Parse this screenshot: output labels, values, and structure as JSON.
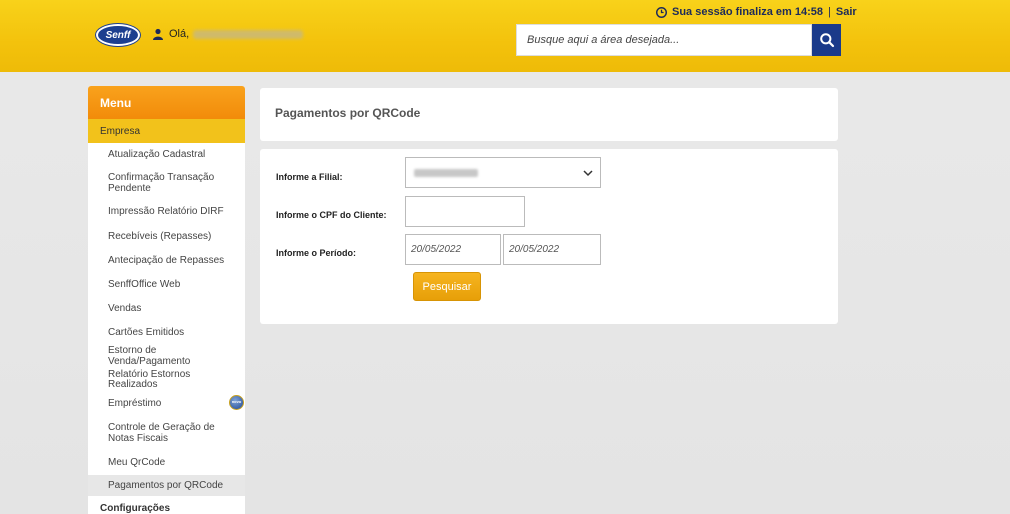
{
  "header": {
    "logo_text": "Senff",
    "greeting": "Olá,",
    "session_text": "Sua sessão finaliza em 14:58",
    "separator": "|",
    "logout_label": "Sair",
    "search_placeholder": "Busque aqui a área desejada..."
  },
  "sidebar": {
    "menu_title": "Menu",
    "section": "Empresa",
    "items": [
      {
        "label": "Atualização Cadastral"
      },
      {
        "label": "Confirmação Transação Pendente"
      },
      {
        "label": "Impressão Relatório DIRF"
      },
      {
        "label": "Recebíveis (Repasses)"
      },
      {
        "label": "Antecipação de Repasses"
      },
      {
        "label": "SenffOffice Web"
      },
      {
        "label": "Vendas"
      },
      {
        "label": "Cartões Emitidos"
      },
      {
        "label": "Estorno de Venda/Pagamento"
      },
      {
        "label": "Relatório Estornos Realizados"
      },
      {
        "label": "Empréstimo",
        "badge": "novo"
      },
      {
        "label": "Controle de Geração de Notas Fiscais"
      },
      {
        "label": "Meu QrCode"
      },
      {
        "label": "Pagamentos por QRCode",
        "active": true
      }
    ],
    "next_section": "Configurações"
  },
  "main": {
    "title": "Pagamentos por QRCode",
    "form": {
      "branch_label": "Informe a Filial:",
      "cpf_label": "Informe o CPF do Cliente:",
      "period_label": "Informe o Período:",
      "cpf_value": "",
      "date_start": "20/05/2022",
      "date_end": "20/05/2022",
      "submit_label": "Pesquisar"
    }
  },
  "colors": {
    "header_yellow": "#f3c20c",
    "menu_orange": "#f28b0a",
    "section_yellow": "#f2c21b",
    "navy": "#1a3a8a",
    "button_orange": "#e79f08"
  }
}
